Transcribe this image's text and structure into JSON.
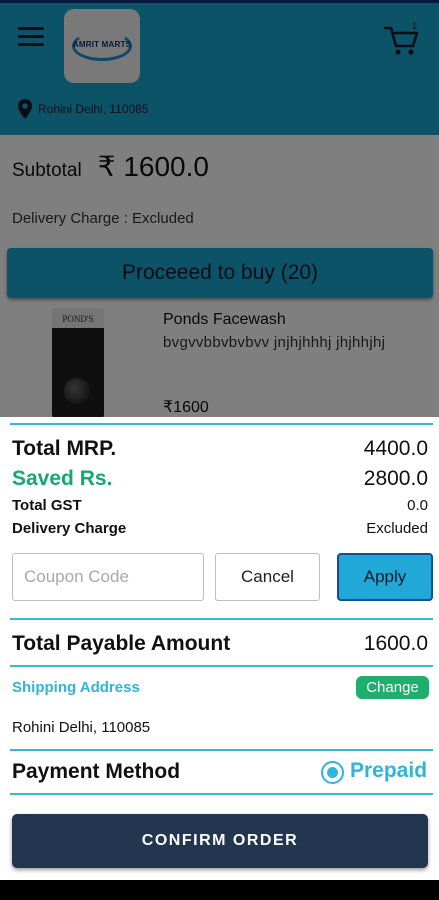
{
  "header": {
    "logo_text": "AMRIT MARTS",
    "cart_count": "1",
    "location": "Rohini Delhi, 110085"
  },
  "cart": {
    "subtotal_label": "Subtotal",
    "subtotal_value": "₹ 1600.0",
    "delivery_note": "Delivery Charge : Excluded",
    "proceed_label": "Proceeed to buy (20)",
    "product": {
      "brand": "POND'S",
      "name": "Ponds Facewash",
      "description": "bvgvvbbvbvbvv jnjhjhhhj  jhjhhjhj",
      "price": "₹1600"
    }
  },
  "summary": {
    "total_mrp_label": "Total MRP.",
    "total_mrp_value": "4400.0",
    "saved_label": "Saved Rs.",
    "saved_value": "2800.0",
    "gst_label": "Total GST",
    "gst_value": "0.0",
    "delivery_label": "Delivery Charge",
    "delivery_value": "Excluded",
    "coupon_placeholder": "Coupon Code",
    "cancel_label": "Cancel",
    "apply_label": "Apply",
    "payable_label": "Total Payable Amount",
    "payable_value": "1600.0",
    "shipping_label": "Shipping Address",
    "change_label": "Change",
    "address": "Rohini Delhi, 110085",
    "payment_label": "Payment Method",
    "payment_option": "Prepaid",
    "confirm_label": "CONFIRM ORDER"
  },
  "colors": {
    "accent": "#1aa6cf",
    "saved_green": "#15a86f",
    "confirm_dark": "#22374f",
    "change_green": "#1fae6c"
  },
  "icons": {
    "menu": "hamburger-menu-icon",
    "cart": "shopping-cart-icon",
    "location": "map-pin-icon",
    "radio": "radio-selected-icon"
  }
}
